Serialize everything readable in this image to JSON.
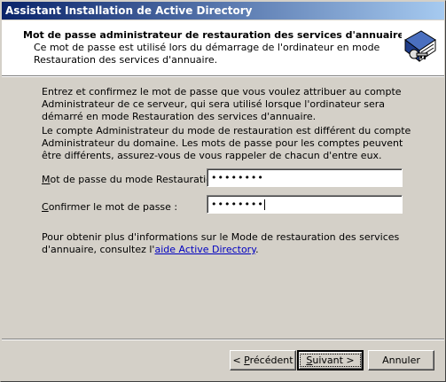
{
  "window": {
    "title": "Assistant Installation de Active Directory"
  },
  "header": {
    "title": "Mot de passe administrateur de restauration des services d'annuaire",
    "subtitle": "Ce mot de passe est utilisé lors du démarrage de l'ordinateur en mode Restauration des services d'annuaire.",
    "icon": "directory-book-icon"
  },
  "body": {
    "paragraph1": "Entrez et confirmez le mot de passe que vous voulez attribuer au compte Administrateur de ce serveur, qui sera utilisé lorsque l'ordinateur sera démarré en mode Restauration des services d'annuaire.",
    "paragraph2": "Le compte Administrateur du mode de restauration est différent du compte Administrateur du domaine. Les mots de passe pour les comptes peuvent être différents, assurez-vous de vous rappeler de chacun d'entre eux.",
    "paragraph3_text": "Pour obtenir plus d'informations sur le Mode de restauration des services d'annuaire, consultez l'",
    "paragraph3_link": "aide Active Directory",
    "paragraph3_end": "."
  },
  "form": {
    "password_label_mnemonic": "M",
    "password_label_rest": "ot de passe du mode Restauration :",
    "password_value": "••••••••",
    "confirm_label_mnemonic": "C",
    "confirm_label_rest": "onfirmer le mot de passe :",
    "confirm_value": "••••••••"
  },
  "buttons": {
    "prev_prefix": "< ",
    "prev_mnemonic": "P",
    "prev_rest": "récédent",
    "next_mnemonic": "S",
    "next_rest": "uivant >",
    "cancel": "Annuler"
  }
}
